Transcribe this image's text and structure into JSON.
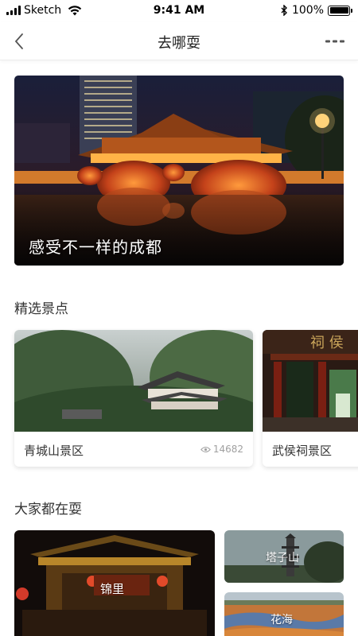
{
  "status_bar": {
    "carrier": "Sketch",
    "time": "9:41 AM",
    "battery": "100%",
    "battery_level": 1.0
  },
  "nav": {
    "title": "去哪耍",
    "back_icon": "chevron-left-icon",
    "more_icon": "more-icon"
  },
  "hero": {
    "title": "感受不一样的成都"
  },
  "featured": {
    "section_title": "精选景点",
    "items": [
      {
        "name": "青城山景区",
        "views": "14682",
        "view_icon": "eye-icon"
      },
      {
        "name": "武侯祠景区"
      }
    ]
  },
  "popular": {
    "section_title": "大家都在耍",
    "items": [
      {
        "name": "锦里"
      },
      {
        "name": "塔子山"
      },
      {
        "name": "花海"
      }
    ]
  },
  "colors": {
    "background": "#ffffff",
    "text_primary": "#222222",
    "text_secondary": "#a0a0a0",
    "divider": "#ececec"
  }
}
